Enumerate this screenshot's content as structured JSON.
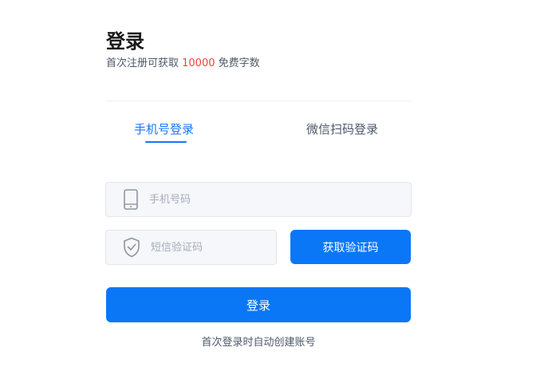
{
  "header": {
    "title": "登录",
    "subtitle_prefix": "首次注册可获取 ",
    "subtitle_highlight": "10000",
    "subtitle_suffix": " 免费字数"
  },
  "tabs": {
    "phone_login": "手机号登录",
    "wechat_login": "微信扫码登录",
    "active": "phone_login"
  },
  "form": {
    "phone_placeholder": "手机号码",
    "phone_value": "",
    "code_placeholder": "短信验证码",
    "code_value": "",
    "get_code_label": "获取验证码",
    "login_label": "登录"
  },
  "footnote": "首次登录时自动创建账号",
  "icons": {
    "phone": "mobile-phone-icon",
    "code": "shield-check-icon"
  },
  "colors": {
    "accent": "#1677ff",
    "button": "#0a77f7",
    "highlight": "#f53f3f"
  }
}
